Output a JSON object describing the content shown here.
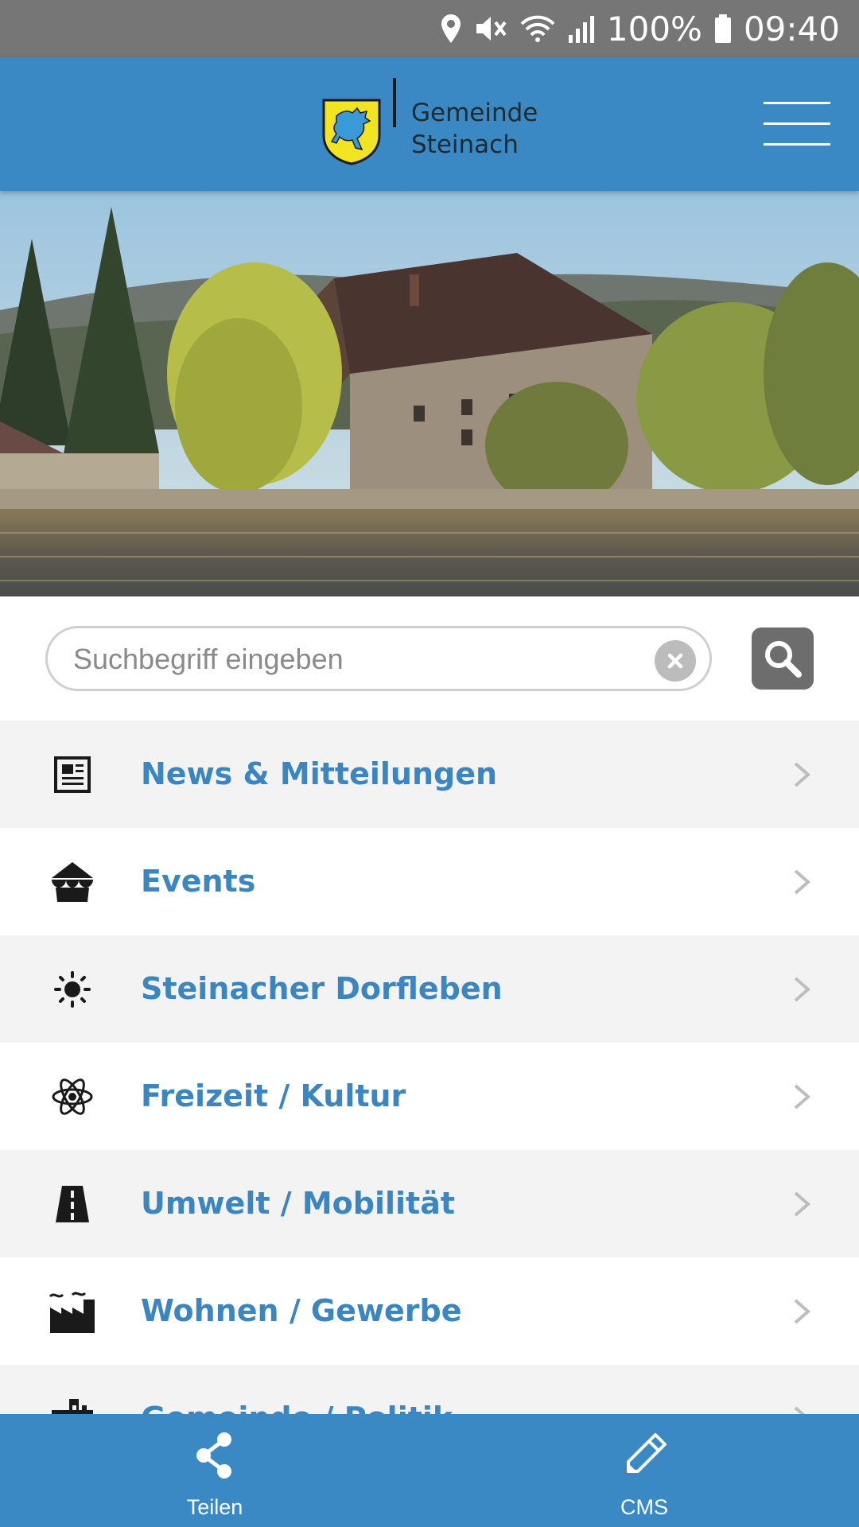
{
  "status_bar": {
    "battery": "100%",
    "time": "09:40",
    "icons": [
      "location-icon",
      "mute-icon",
      "wifi-icon",
      "signal-icon",
      "battery-icon"
    ]
  },
  "header": {
    "logo_line1": "Gemeinde",
    "logo_line2": "Steinach",
    "menu_icon": "hamburger-icon",
    "background": "#3a89c4"
  },
  "search": {
    "placeholder": "Suchbegriff eingeben",
    "value": "",
    "clear_icon": "clear-icon",
    "button_icon": "search-icon"
  },
  "menu": {
    "items": [
      {
        "label": "News & Mitteilungen",
        "icon": "newspaper-icon"
      },
      {
        "label": "Events",
        "icon": "tent-icon"
      },
      {
        "label": "Steinacher Dorfleben",
        "icon": "sun-icon"
      },
      {
        "label": "Freizeit / Kultur",
        "icon": "atom-icon"
      },
      {
        "label": "Umwelt / Mobilität",
        "icon": "road-icon"
      },
      {
        "label": "Wohnen / Gewerbe",
        "icon": "factory-icon"
      },
      {
        "label": "Gemeinde / Politik",
        "icon": "buildings-icon"
      }
    ],
    "accent": "#3b86c0"
  },
  "bottom_bar": {
    "share_label": "Teilen",
    "cms_label": "CMS",
    "share_icon": "share-icon",
    "cms_icon": "pencil-icon"
  }
}
